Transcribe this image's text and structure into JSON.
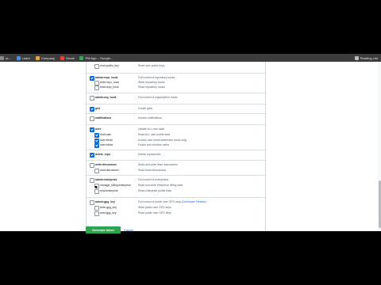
{
  "bookmarks": {
    "items": [
      {
        "label": "ut...",
        "color": "#888888"
      },
      {
        "label": "Learn",
        "color": "#4a90e2"
      },
      {
        "label": "Company",
        "color": "#e8a33d"
      },
      {
        "label": "Gmail",
        "color": "#ea4335"
      },
      {
        "label": "PM App – Google...",
        "color": "#34a853"
      }
    ],
    "reading_list": "Reading List"
  },
  "scopes": {
    "rows": [
      {
        "name": "read:public_key",
        "desc": "Read user public keys",
        "checked": false,
        "child": true,
        "partial": true
      },
      {
        "name": "admin:repo_hook",
        "desc": "Full control of repository hooks",
        "checked": true,
        "child": false
      },
      {
        "name": "write:repo_hook",
        "desc": "Write repository hooks",
        "checked": false,
        "child": true
      },
      {
        "name": "read:repo_hook",
        "desc": "Read repository hooks",
        "checked": false,
        "child": true
      },
      {
        "name": "admin:org_hook",
        "desc": "Full control of organization hooks",
        "checked": false,
        "child": false
      },
      {
        "name": "gist",
        "desc": "Create gists",
        "checked": true,
        "child": false
      },
      {
        "name": "notifications",
        "desc": "Access notifications",
        "checked": false,
        "child": false
      },
      {
        "name": "user",
        "desc": "Update ALL user data",
        "checked": true,
        "child": false
      },
      {
        "name": "read:user",
        "desc": "Read ALL user profile data",
        "checked": true,
        "child": true
      },
      {
        "name": "user:email",
        "desc": "Access user email addresses (read-only)",
        "checked": true,
        "child": true
      },
      {
        "name": "user:follow",
        "desc": "Follow and unfollow users",
        "checked": true,
        "child": true
      },
      {
        "name": "delete_repo",
        "desc": "Delete repositories",
        "checked": true,
        "child": false
      },
      {
        "name": "write:discussion",
        "desc": "Read and write team discussions",
        "checked": false,
        "child": false
      },
      {
        "name": "read:discussion",
        "desc": "Read team discussions",
        "checked": false,
        "child": true
      },
      {
        "name": "admin:enterprise",
        "desc": "Full control of enterprises",
        "checked": false,
        "child": false
      },
      {
        "name": "manage_billing:enterprise",
        "desc": "Read and write enterprise billing data",
        "checked": false,
        "child": true
      },
      {
        "name": "read:enterprise",
        "desc": "Read enterprise profile data",
        "checked": false,
        "child": true
      },
      {
        "name": "admin:gpg_key",
        "desc": "Full control of public user GPG keys",
        "desc_link": "(Developer Preview)",
        "checked": false,
        "child": false
      },
      {
        "name": "write:gpg_key",
        "desc": "Write public user GPG keys",
        "checked": false,
        "child": true
      },
      {
        "name": "read:gpg_key",
        "desc": "Read public user GPG keys",
        "checked": false,
        "child": true
      }
    ]
  },
  "actions": {
    "generate_label": "Generate token",
    "cancel_label": "Cancel"
  },
  "colors": {
    "accent": "#0969da",
    "primary_button": "#2da44e"
  }
}
